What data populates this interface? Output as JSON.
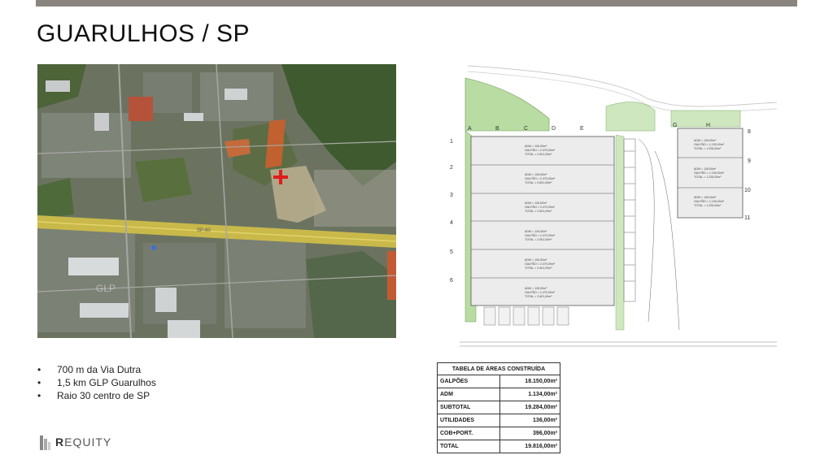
{
  "slide": {
    "title": "GUARULHOS / SP"
  },
  "bullets": [
    "700 m da Via Dutra",
    "1,5 km GLP Guarulhos",
    "Raio 30 centro de SP"
  ],
  "logo": {
    "initial": "R",
    "rest": "EQUITY"
  },
  "map_labels": {
    "highway": "SP-60",
    "center": "SITE",
    "glp": "GLP"
  },
  "plan": {
    "columns": [
      "A",
      "B",
      "C",
      "D",
      "E",
      "G",
      "H"
    ],
    "rows": [
      "1",
      "2",
      "3",
      "4",
      "5",
      "6",
      "8",
      "9",
      "10",
      "11"
    ],
    "warehouse_blocks": [
      [
        "ADM = 126,00m²",
        "GALPÃO = 2.470,00m²",
        "TOTAL = 2.601,00m²"
      ],
      [
        "ADM = 126,00m²",
        "GALPÃO = 2.470,00m²",
        "TOTAL = 2.601,00m²"
      ],
      [
        "ADM = 126,00m²",
        "GALPÃO = 2.470,00m²",
        "TOTAL = 2.601,00m²"
      ],
      [
        "ADM = 126,00m²",
        "GALPÃO = 2.470,00m²",
        "TOTAL = 2.601,00m²"
      ],
      [
        "ADM = 126,00m²",
        "GALPÃO = 2.470,00m²",
        "TOTAL = 2.601,00m²"
      ],
      [
        "ADM = 126,00m²",
        "GALPÃO = 2.470,00m²",
        "TOTAL = 2.601,00m²"
      ]
    ],
    "right_blocks": [
      [
        "ADM = 126,00m²",
        "GALPÃO = 1.100,00m²",
        "TOTAL = 1.226,00m²"
      ],
      [
        "ADM = 126,00m²",
        "GALPÃO = 1.100,00m²",
        "TOTAL = 1.226,00m²"
      ],
      [
        "ADM = 126,00m²",
        "GALPÃO = 1.100,00m²",
        "TOTAL = 1.226,00m²"
      ]
    ]
  },
  "area_table": {
    "header": "TABELA DE ÁREAS CONSTRUÍDA",
    "rows": [
      {
        "label": "GALPÕES",
        "value": "18.150,00m²"
      },
      {
        "label": "ADM",
        "value": "1.134,00m²"
      },
      {
        "label": "SUBTOTAL",
        "value": "19.284,00m²"
      },
      {
        "label": "UTILIDADES",
        "value": "136,00m²"
      },
      {
        "label": "COB+PORT.",
        "value": "396,00m²"
      },
      {
        "label": "TOTAL",
        "value": "19.816,00m²"
      }
    ]
  }
}
